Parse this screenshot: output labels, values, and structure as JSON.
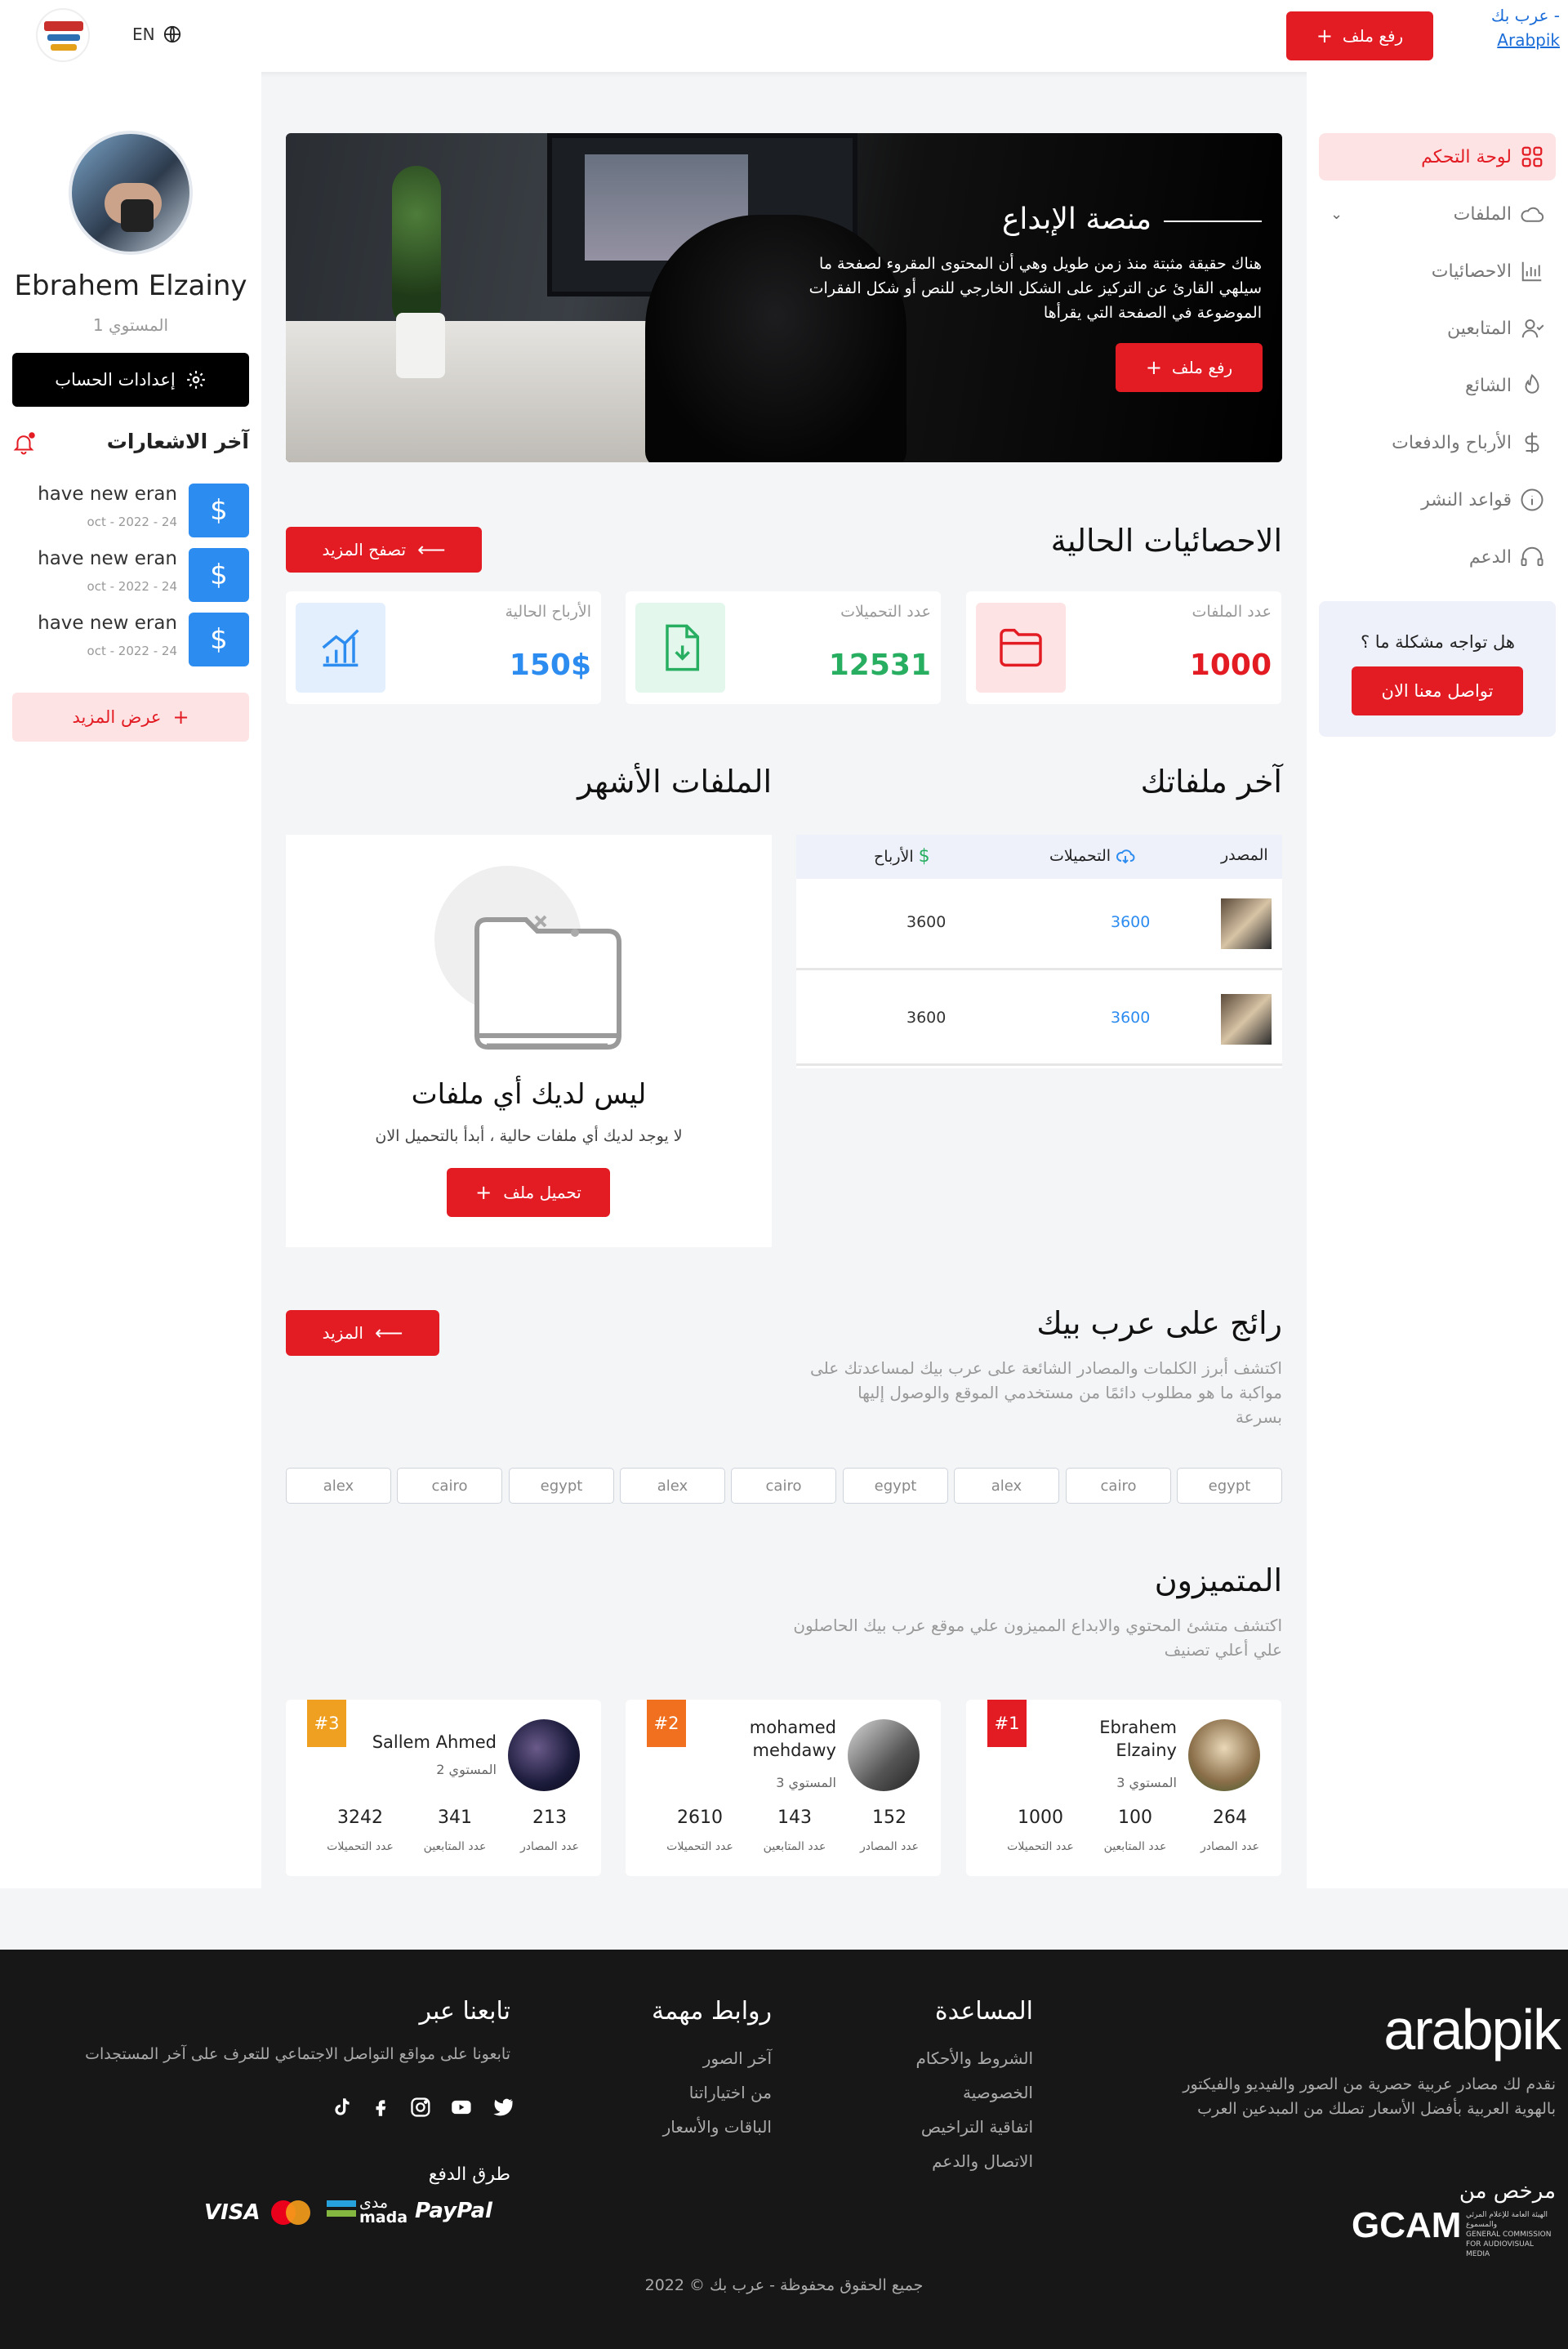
{
  "header": {
    "brand_alt": "عرب بك - Arabpik",
    "brand_alt_line1": "عرب بك -",
    "brand_alt_line2": "Arabpik",
    "upload_label": "رفع ملف",
    "lang": "EN"
  },
  "nav": {
    "items": [
      {
        "label": "لوحة التحكم",
        "icon": "dashboard-icon",
        "active": true
      },
      {
        "label": "الملفات",
        "icon": "cloud-icon"
      },
      {
        "label": "الاحصائيات",
        "icon": "chart-icon"
      },
      {
        "label": "المتابعين",
        "icon": "users-icon"
      },
      {
        "label": "الشائع",
        "icon": "fire-icon"
      },
      {
        "label": "الأرباح والدفعات",
        "icon": "dollar-icon"
      },
      {
        "label": "قواعد النشر",
        "icon": "info-icon"
      },
      {
        "label": "الدعم",
        "icon": "headset-icon"
      }
    ],
    "help_title": "هل تواجه مشكلة ما ؟",
    "help_button": "تواصل معنا الان"
  },
  "profile": {
    "name": "Ebrahem Elzainy",
    "level": "المستوي 1",
    "settings_button": "إعدادات الحساب",
    "notifications_title": "آخر الاشعارات",
    "notifications": [
      {
        "text": "have new eran",
        "date": "oct - 2022 - 24"
      },
      {
        "text": "have new eran",
        "date": "oct - 2022 - 24"
      },
      {
        "text": "have new eran",
        "date": "oct - 2022 - 24"
      }
    ],
    "show_more": "عرض المزيد"
  },
  "hero": {
    "title": "منصة الإبداع",
    "text": "هناك حقيقة مثبتة منذ زمن طويل وهي أن المحتوى المقروء لصفحة ما سيلهي القارئ عن التركيز على الشكل الخارجي للنص أو شكل الفقرات الموضوعة في الصفحة التي يقرأها",
    "button": "رفع ملف"
  },
  "stats": {
    "title": "الاحصائيات الحالية",
    "browse_more": "تصفح المزيد",
    "cards": [
      {
        "label": "عدد الملفات",
        "value": "1000",
        "color": "#e31b23"
      },
      {
        "label": "عدد التحميلات",
        "value": "12531",
        "color": "#27ae60"
      },
      {
        "label": "الأرباح الحالية",
        "value": "150$",
        "color": "#2d8cf0"
      }
    ]
  },
  "latest_files": {
    "title": "آخر ملفاتك",
    "headers": {
      "source": "المصدر",
      "downloads": "التحميلات",
      "earnings": "الأرباح"
    },
    "rows": [
      {
        "downloads": "3600",
        "earnings": "3600"
      },
      {
        "downloads": "3600",
        "earnings": "3600"
      }
    ]
  },
  "popular_files": {
    "title": "الملفات الأشهر",
    "empty_title": "ليس لديك أي ملفات",
    "empty_sub": "لا يوجد لديك أي ملفات حالية ، أبدأ بالتحميل الان",
    "upload_button": "تحميل ملف"
  },
  "trending": {
    "title": "رائج على عرب بيك",
    "desc": "اكتشف أبرز الكلمات والمصادر الشائعة على عرب بيك لمساعدتك على مواكبة ما هو مطلوب دائمًا من مستخدمي الموقع والوصول إليها بسرعة",
    "more": "المزيد",
    "tags": [
      "egypt",
      "cairo",
      "alex",
      "egypt",
      "cairo",
      "alex",
      "egypt",
      "cairo",
      "alex"
    ]
  },
  "featured": {
    "title": "المتميزون",
    "desc": "اكتشف متشئ المحتوي والابداع المميزون علي موقع عرب بيك الحاصلون علي أعلي تصنيف",
    "stat_labels": {
      "sources": "عدد المصادر",
      "followers": "عدد المتابعين",
      "downloads": "عدد التحميلات"
    },
    "users": [
      {
        "rank": "#1",
        "name": "Ebrahem Elzainy",
        "level": "المستوي 3",
        "sources": "264",
        "followers": "100",
        "downloads": "1000",
        "rank_color": "#e31b23"
      },
      {
        "rank": "#2",
        "name": "mohamed mehdawy",
        "level": "المستوي 3",
        "sources": "152",
        "followers": "143",
        "downloads": "2610",
        "rank_color": "#f07020"
      },
      {
        "rank": "#3",
        "name": "Sallem Ahmed",
        "level": "المستوي 2",
        "sources": "213",
        "followers": "341",
        "downloads": "3242",
        "rank_color": "#f0a020"
      }
    ]
  },
  "footer": {
    "logo": "arabpik",
    "about": "نقدم لك مصادر عربية حصرية من الصور والفيديو والفيكتور بالهوية العربية بأفضل الأسعار تصلك من المبدعين العرب",
    "licensed": "مرخص من",
    "gcam": "GCAM",
    "gcam_sub_ar": "الهيئة العامة للإعلام المرئي والمسموع",
    "gcam_sub_en": "GENERAL COMMISSION FOR AUDIOVISUAL MEDIA",
    "help_title": "المساعدة",
    "help_links": [
      "الشروط والأحكام",
      "الخصوصية",
      "اتفاقية التراخيص",
      "الاتصال والدعم"
    ],
    "links_title": "روابط مهمة",
    "links": [
      "آخر الصور",
      "من اختياراتنا",
      "الباقات والأسعار"
    ],
    "follow_title": "تابعنا عبر",
    "follow_text": "تابعونا على مواقع التواصل الاجتماعي للتعرف على آخر المستجدات",
    "payment_title": "طرق الدفع",
    "payments": {
      "visa": "VISA",
      "mada_ar": "مدى",
      "mada_en": "mada",
      "paypal": "PayPal"
    },
    "copyright": "جميع الحقوق محفوظة - عرب بك © 2022"
  }
}
